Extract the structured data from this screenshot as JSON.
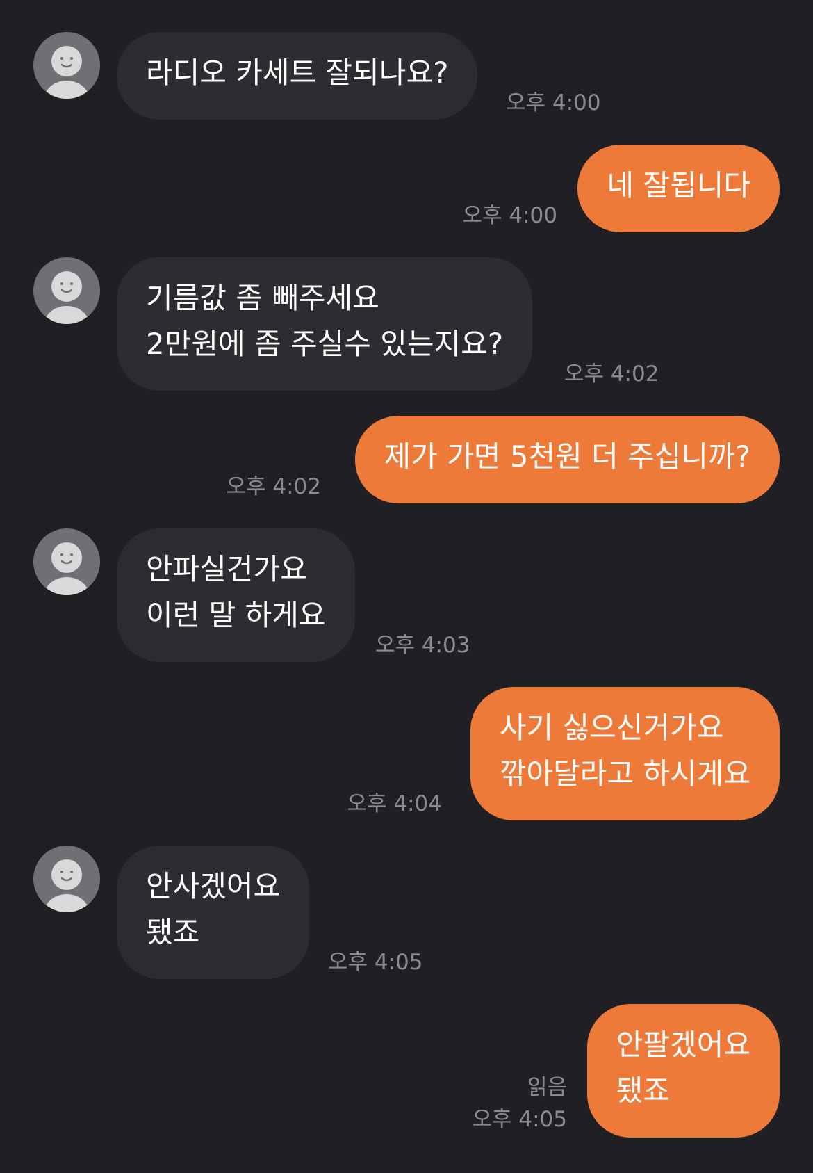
{
  "colors": {
    "background": "#202024",
    "incoming_bubble": "#2b2d31",
    "outgoing_bubble": "#ee7a3a",
    "timestamp_text": "#8a8b90"
  },
  "avatar_icon": "person-silhouette-icon",
  "messages": [
    {
      "side": "in",
      "lines": [
        "라디오 카세트 잘되나요?"
      ],
      "time": "오후 4:00"
    },
    {
      "side": "out",
      "lines": [
        "네 잘됩니다"
      ],
      "time": "오후 4:00"
    },
    {
      "side": "in",
      "lines": [
        "기름값 좀 빼주세요",
        "2만원에 좀 주실수 있는지요?"
      ],
      "time": "오후 4:02"
    },
    {
      "side": "out",
      "lines": [
        "제가 가면 5천원 더 주십니까?"
      ],
      "time": "오후 4:02"
    },
    {
      "side": "in",
      "lines": [
        "안파실건가요",
        "이런 말 하게요"
      ],
      "time": "오후 4:03"
    },
    {
      "side": "out",
      "lines": [
        "사기 싫으신거가요",
        "깎아달라고 하시게요"
      ],
      "time": "오후 4:04"
    },
    {
      "side": "in",
      "lines": [
        "안사겠어요",
        "됐죠"
      ],
      "time": "오후 4:05"
    },
    {
      "side": "out",
      "lines": [
        "안팔겠어요",
        "됐죠"
      ],
      "time": "오후 4:05",
      "read": "읽음"
    }
  ]
}
